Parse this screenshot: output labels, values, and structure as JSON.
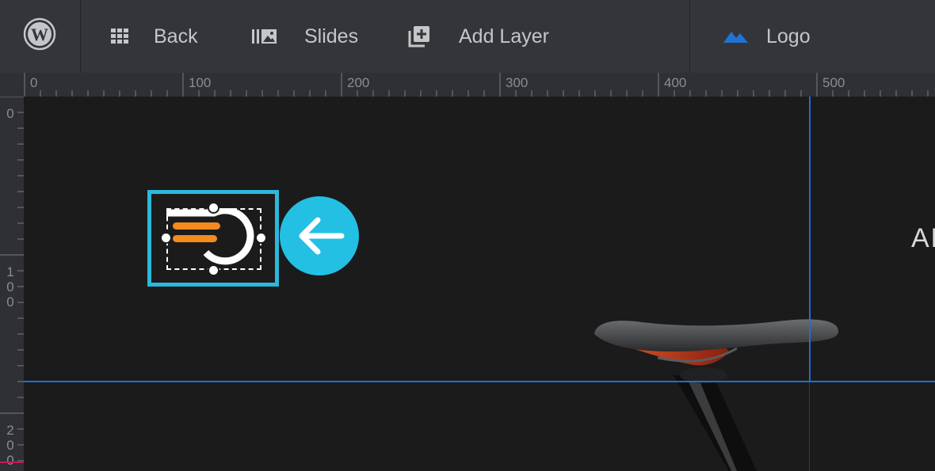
{
  "toolbar": {
    "back_label": "Back",
    "slides_label": "Slides",
    "add_layer_label": "Add Layer",
    "logo_label": "Logo"
  },
  "ruler": {
    "top_ticks": [
      "0",
      "100",
      "200",
      "300",
      "400",
      "500"
    ],
    "left_ticks": [
      [
        "0"
      ],
      [
        "1",
        "0",
        "0"
      ],
      [
        "2",
        "0",
        "0"
      ]
    ]
  },
  "canvas": {
    "side_text": "AE"
  },
  "colors": {
    "accent": "#23c0e4",
    "guide": "#1f6fd0",
    "logo_orange": "#f58a1f"
  }
}
